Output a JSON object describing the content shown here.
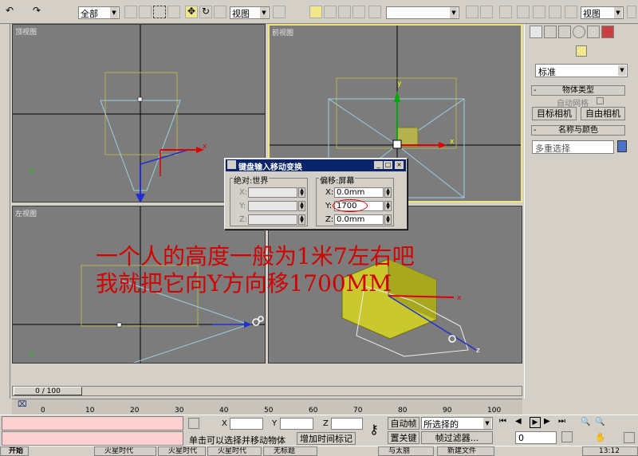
{
  "toolbar": {
    "filter_select": "全部",
    "view_select_left": "视图",
    "view_select_right": "视图",
    "named_selection": ""
  },
  "viewports": {
    "top": "顶视图",
    "front": "前视图",
    "left": "左视图"
  },
  "axis": {
    "x": "x",
    "y": "y",
    "z": "z"
  },
  "command_panel": {
    "standard": "标准",
    "object_type_header": "物体类型",
    "auto_grid": "自动网格",
    "target_camera": "目标相机",
    "free_camera": "自由相机",
    "name_color_header": "名称与颜色",
    "name_field": "多重选择",
    "swatch_color": "#4a73c9"
  },
  "dialog": {
    "title": "键盘输入移动变换",
    "absolute_group": "绝对:世界",
    "offset_group": "偏移:屏幕",
    "abs_x_label": "X:",
    "abs_y_label": "Y:",
    "abs_z_label": "Z:",
    "off_x_label": "X:",
    "off_y_label": "Y:",
    "off_z_label": "Z:",
    "off_x": "0.0mm",
    "off_y": "1700",
    "off_z": "0.0mm"
  },
  "overlay": {
    "line1": "一个人的高度一般为1米7左右吧",
    "line2": "我就把它向Y方向移1700MM"
  },
  "timeline": {
    "frame_counter": "0 / 100",
    "ticks": [
      "0",
      "10",
      "20",
      "30",
      "40",
      "50",
      "60",
      "70",
      "80",
      "90",
      "100"
    ]
  },
  "status": {
    "hint": "单击可以选择并移动物体",
    "add_time_tag": "增加时间标记",
    "x_label": "X",
    "y_label": "Y",
    "z_label": "Z",
    "auto_key": "自动帧",
    "set_key": "置关键",
    "selection_select": "所选择的",
    "key_filters": "帧过滤器...",
    "frame_field": "0"
  },
  "taskbar": {
    "start": "开始",
    "items": [
      "火星时代",
      "火星时代",
      "火星时代",
      "无标题",
      "与太丽",
      "新建文件"
    ],
    "clock": "13:12"
  }
}
